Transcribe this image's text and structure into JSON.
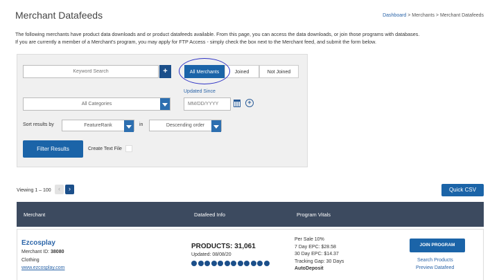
{
  "page": {
    "title": "Merchant Datafeeds",
    "breadcrumb": {
      "home": "Dashboard",
      "rest": " > Merchants > Merchant Datafeeds"
    },
    "intro_line1": "The following merchants have product data downloads and or product datafeeds available. From this page, you can access the data downloads, or join those programs with databases.",
    "intro_line2": "If you are currently a member of a Merchant's program, you may apply for FTP Access - simply check the box next to the Merchant feed, and submit the form below."
  },
  "filters": {
    "keyword_placeholder": "Keyword Search",
    "plus_label": "+",
    "segments": {
      "all": "All Merchants",
      "joined": "Joined",
      "not_joined": "Not Joined"
    },
    "updated_since_label": "Updated Since",
    "category_value": "All Categories",
    "date_placeholder": "MM/DD/YYYY",
    "sort_label": "Sort results by",
    "sort_value": "FeatureRank",
    "in_label": "in",
    "order_value": "Descending order",
    "filter_button": "Filter Results",
    "create_text_file_label": "Create Text File"
  },
  "pagination": {
    "viewing": "Viewing 1 – 100",
    "prev": "‹",
    "next": "›"
  },
  "quick_csv": "Quick CSV",
  "table": {
    "headers": {
      "merchant": "Merchant",
      "datafeed": "Datafeed Info",
      "vitals": "Program Vitals"
    },
    "rows": [
      {
        "name": "Ezcosplay",
        "id_label": "Merchant ID: ",
        "id_value": "38080",
        "category": "Clothing",
        "url": "www.ezcosplay.com",
        "products": "PRODUCTS: 31,061",
        "updated": "Updated: 08/08/20",
        "dots": 12,
        "vitals": [
          "Per Sale 10%",
          "7 Day EPC: $28.58",
          "30 Day EPC: $14.37",
          "Tracking Gap: 30 Days"
        ],
        "auto_deposit": "AutoDeposit",
        "join_label": "JOIN PROGRAM",
        "search_label": "Search Products",
        "preview_label": "Preview Datafeed"
      }
    ]
  },
  "colors": {
    "primary": "#1b64a8",
    "header_bg": "#3c4a5f",
    "link": "#2a64a8",
    "annotation": "#2b2fc4"
  }
}
